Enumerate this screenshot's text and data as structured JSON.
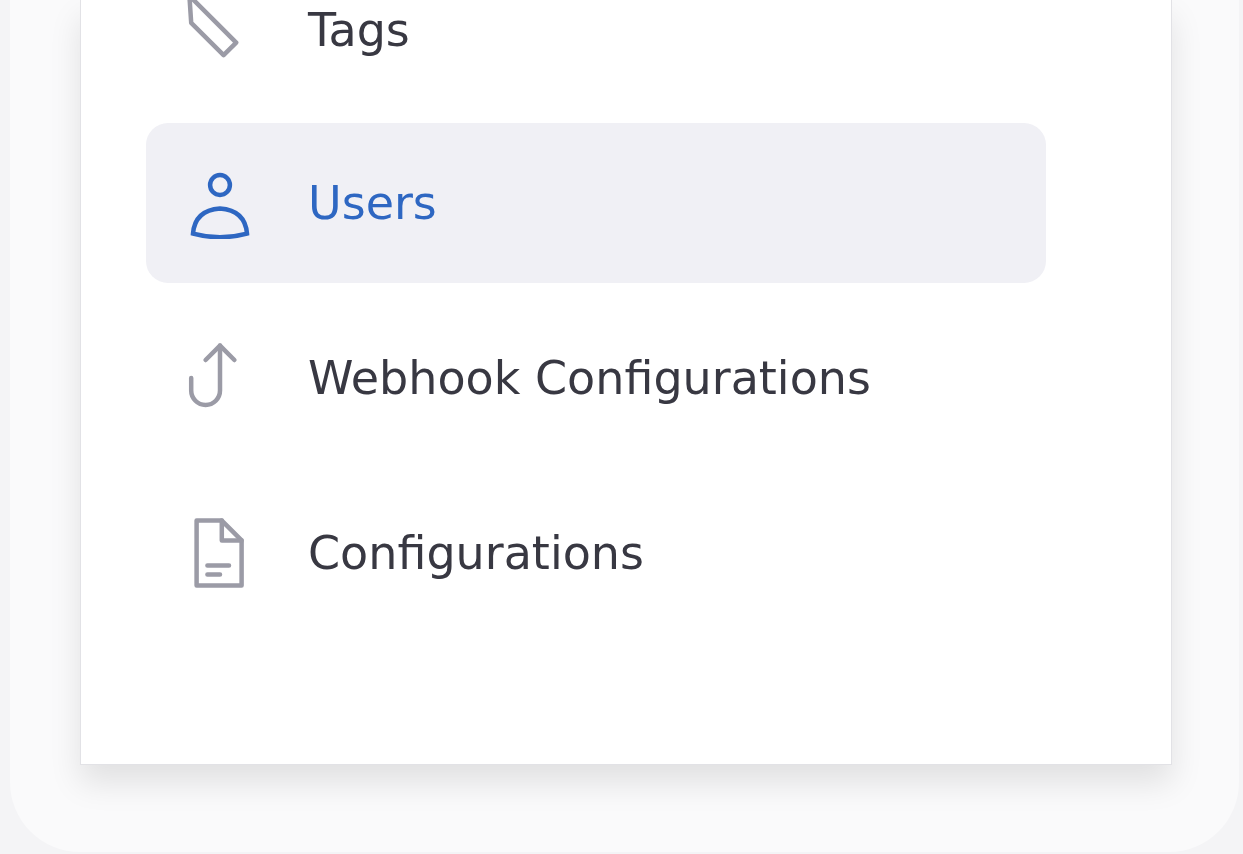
{
  "menu": {
    "items": [
      {
        "label": "Tags",
        "selected": false
      },
      {
        "label": "Users",
        "selected": true
      },
      {
        "label": "Webhook Configurations",
        "selected": false
      },
      {
        "label": "Configurations",
        "selected": false
      }
    ]
  }
}
